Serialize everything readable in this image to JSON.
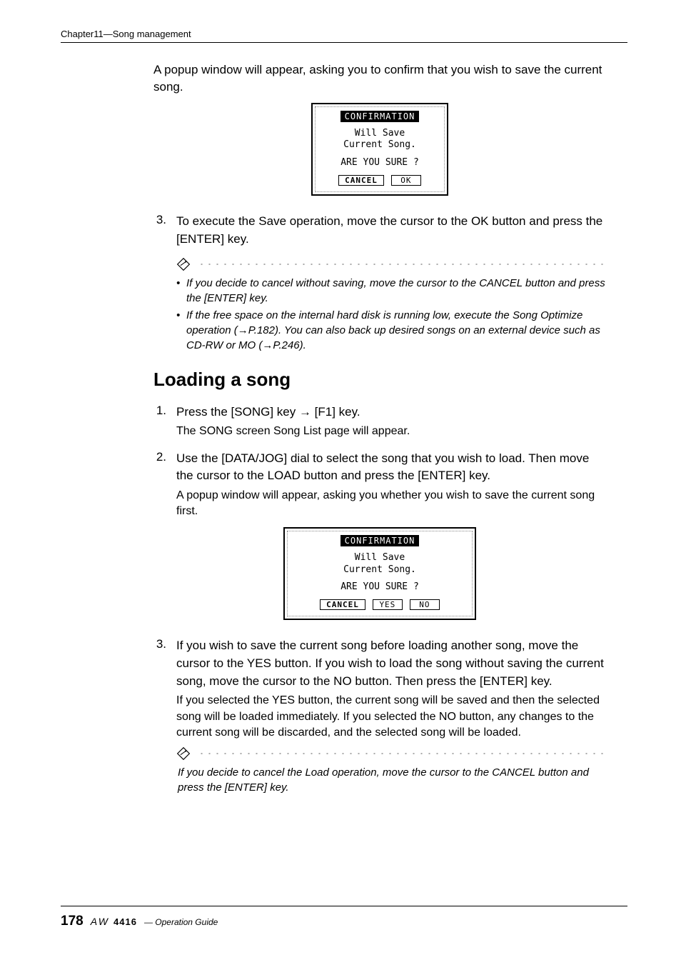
{
  "header": {
    "chapter": "Chapter11—Song management"
  },
  "intro": "A popup window will appear, asking you to confirm that you wish to save the current song.",
  "dialog1": {
    "title": "CONFIRMATION",
    "line1": "Will Save",
    "line2": "Current Song.",
    "prompt": "ARE YOU SURE ?",
    "cancel": "CANCEL",
    "ok": "OK"
  },
  "step3a": {
    "num": "3.",
    "head": "To execute the Save operation, move the cursor to the OK button and press the [ENTER] key."
  },
  "note1": {
    "items": [
      "If you decide to cancel without saving, move the cursor to the CANCEL button and press the [ENTER] key.",
      "If the free space on the internal hard disk is running low, execute the Song Optimize operation (→P.182). You can also back up desired songs on an external device such as CD-RW or MO (→P.246)."
    ]
  },
  "heading": "Loading a song",
  "step1": {
    "num": "1.",
    "head": "Press the [SONG] key → [F1] key.",
    "sub": "The SONG screen Song List page will appear."
  },
  "step2": {
    "num": "2.",
    "head": "Use the [DATA/JOG] dial to select the song that you wish to load. Then move the cursor to the LOAD button and press the [ENTER] key.",
    "sub": "A popup window will appear, asking you whether you wish to save the current song first."
  },
  "dialog2": {
    "title": "CONFIRMATION",
    "line1": "Will Save",
    "line2": "Current Song.",
    "prompt": "ARE YOU SURE ?",
    "cancel": "CANCEL",
    "yes": "YES",
    "no": "NO"
  },
  "step3b": {
    "num": "3.",
    "head": "If you wish to save the current song before loading another song, move the cursor to the YES button. If you wish to load the song without saving the current song, move the cursor to the NO button. Then press the [ENTER] key.",
    "sub": "If you selected the YES button, the current song will be saved and then the selected song will be loaded immediately. If you selected the NO button, any changes to the current song will be discarded, and the selected song will be loaded."
  },
  "note2": {
    "text": "If you decide to cancel the Load operation, move the cursor to the CANCEL button and press the [ENTER] key."
  },
  "footer": {
    "page": "178",
    "brand_italic": "AW",
    "brand_model": "4416",
    "guide": "— Operation Guide"
  }
}
